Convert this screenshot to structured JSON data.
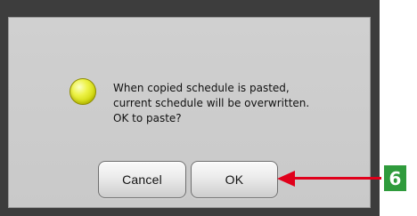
{
  "dialog": {
    "icon": "info-light-icon",
    "message_lines": [
      "When copied schedule is pasted,",
      "current schedule will be overwritten.",
      "OK to paste?"
    ],
    "buttons": {
      "cancel": "Cancel",
      "ok": "OK"
    }
  },
  "callout": {
    "number": "6",
    "color_arrow": "#e0001b",
    "color_badge": "#2f9b3c"
  }
}
